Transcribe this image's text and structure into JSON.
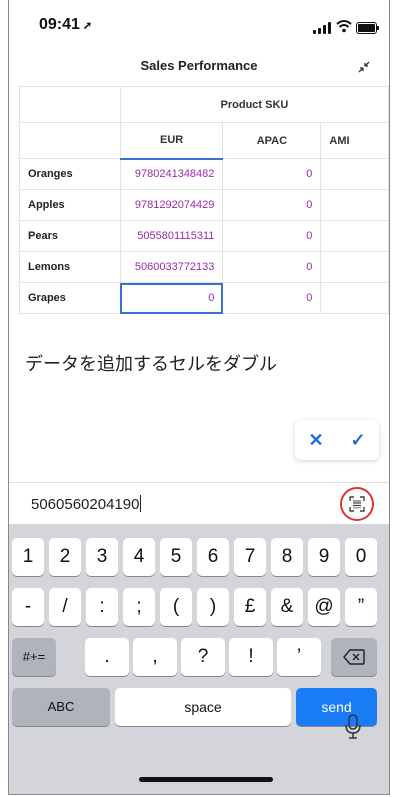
{
  "status": {
    "time": "09:41",
    "location_icon": "location-arrow-icon"
  },
  "header": {
    "title": "Sales Performance",
    "collapse_icon": "collapse-icon"
  },
  "table": {
    "group_header": "Product SKU",
    "columns": [
      "EUR",
      "APAC",
      "AMI"
    ],
    "rows": [
      {
        "label": "Oranges",
        "eur": "9780241348482",
        "apac": "0"
      },
      {
        "label": "Apples",
        "eur": "9781292074429",
        "apac": "0"
      },
      {
        "label": "Pears",
        "eur": "5055801115311",
        "apac": "0"
      },
      {
        "label": "Lemons",
        "eur": "5060033772133",
        "apac": "0"
      },
      {
        "label": "Grapes",
        "eur": "0",
        "apac": "0"
      }
    ]
  },
  "hint": "データを追加するセルをダブル",
  "confirm": {
    "cancel": "✕",
    "accept": "✓"
  },
  "input": {
    "value": "5060560204190",
    "scan_icon": "barcode-scan-icon"
  },
  "keyboard": {
    "row1": [
      "1",
      "2",
      "3",
      "4",
      "5",
      "6",
      "7",
      "8",
      "9",
      "0"
    ],
    "row2": [
      "-",
      "/",
      ":",
      ";",
      "(",
      ")",
      "£",
      "&",
      "@",
      "”"
    ],
    "row3_left": "#+=",
    "row3": [
      ".",
      ",",
      "?",
      "!",
      "’"
    ],
    "abc": "ABC",
    "space": "space",
    "send": "send"
  },
  "colors": {
    "accent": "#1a7cf5",
    "value_text": "#9c2aa8",
    "scan_ring": "#dd3333"
  }
}
